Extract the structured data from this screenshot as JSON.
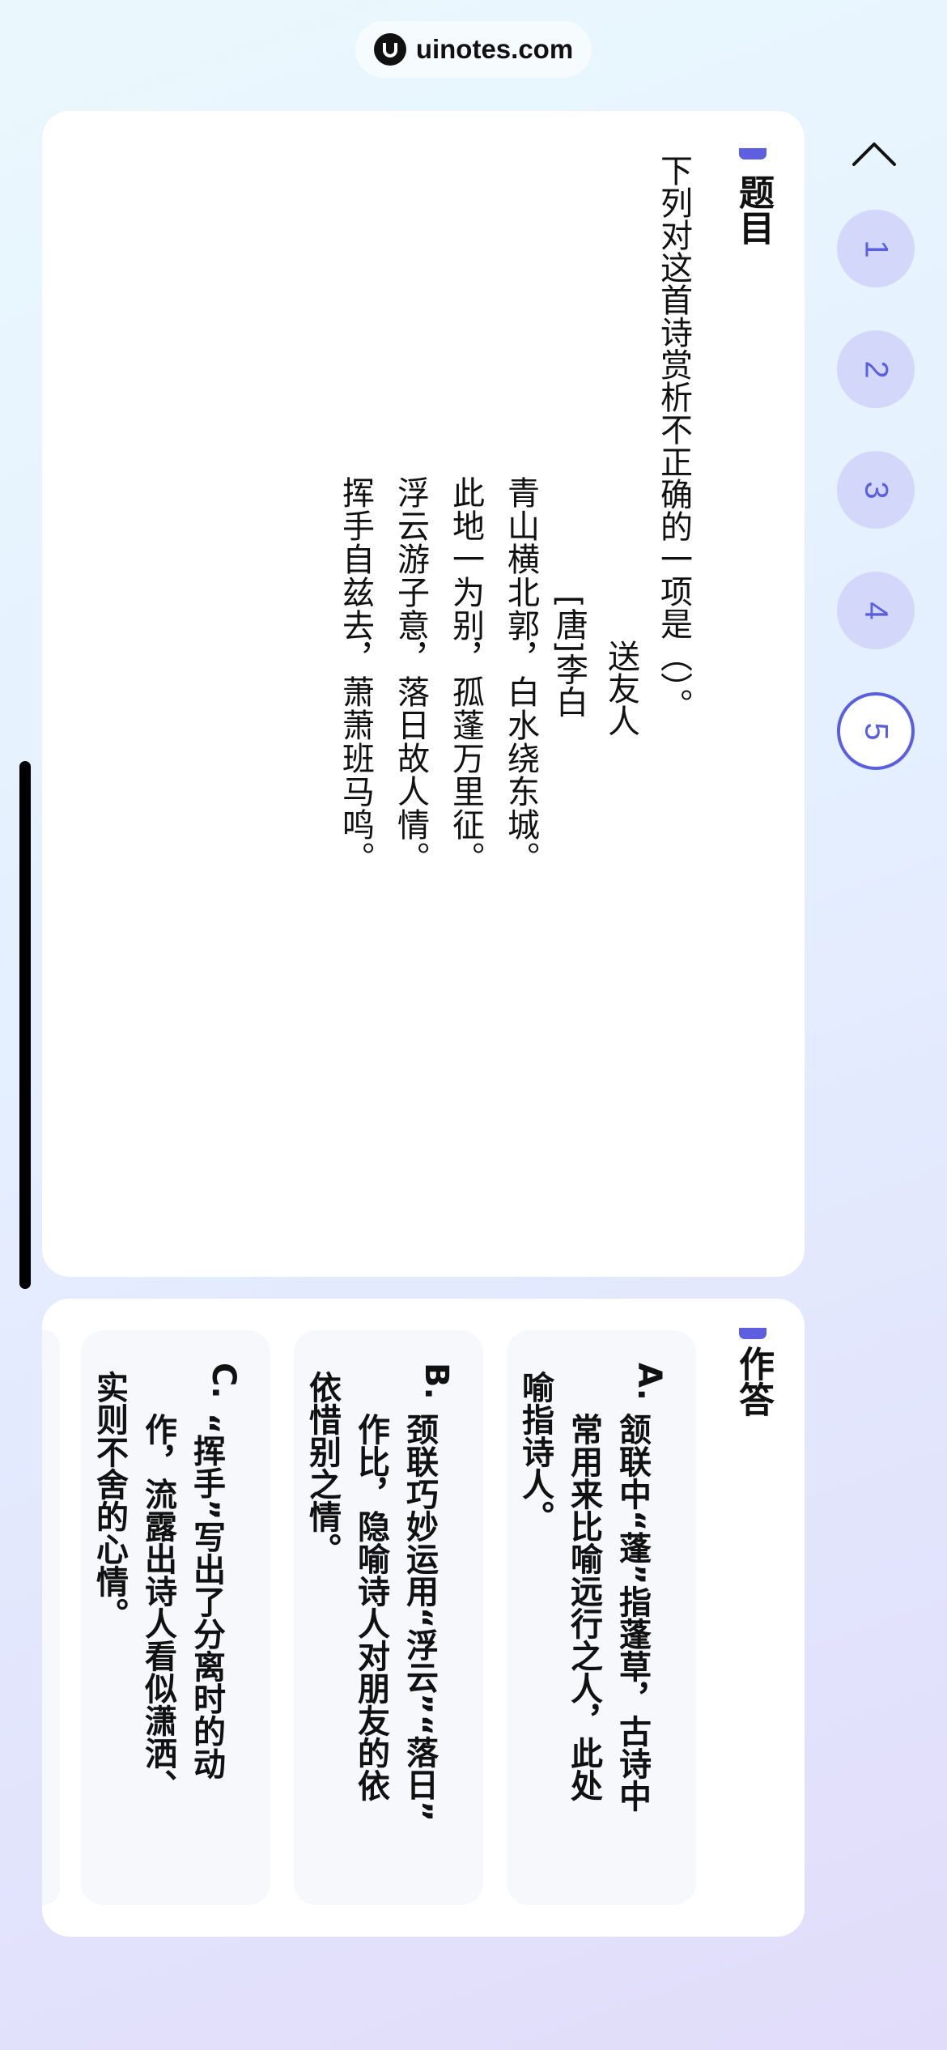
{
  "watermark": {
    "text": "uinotes.com"
  },
  "question": {
    "section_title": "题目",
    "prompt": "下列对这首诗赏析不正确的一项是（）。",
    "poem": {
      "title": "送友人",
      "author": "[唐]李白",
      "lines": [
        "青山横北郭，白水绕东城。",
        "此地一为别，孤蓬万里征。",
        "浮云游子意，落日故人情。",
        "挥手自兹去，萧萧班马鸣。"
      ]
    }
  },
  "answer": {
    "section_title": "作答",
    "options": [
      {
        "letter": "A.",
        "lines": [
          "颔联中“蓬”指蓬草，古诗中",
          "常用来比喻远行之人，此处",
          "喻指诗人。"
        ]
      },
      {
        "letter": "B.",
        "lines": [
          "颈联巧妙运用“浮云”“落日”",
          "作比，隐喻诗人对朋友的依",
          "依惜别之情。"
        ]
      },
      {
        "letter": "C.",
        "lines": [
          "“挥手”写出了分离时的动",
          "作，流露出诗人看似潇洒、",
          "实则不舍的心情。"
        ]
      }
    ]
  },
  "question_nav": {
    "numbers": [
      "1",
      "2",
      "3",
      "4",
      "5"
    ],
    "active": "5"
  },
  "colors": {
    "accent": "#5d5fe0",
    "nav_bg": "#d3d8fb"
  },
  "icons": {
    "collapse": "chevron-up-icon",
    "logo": "uinotes-logo-icon"
  }
}
